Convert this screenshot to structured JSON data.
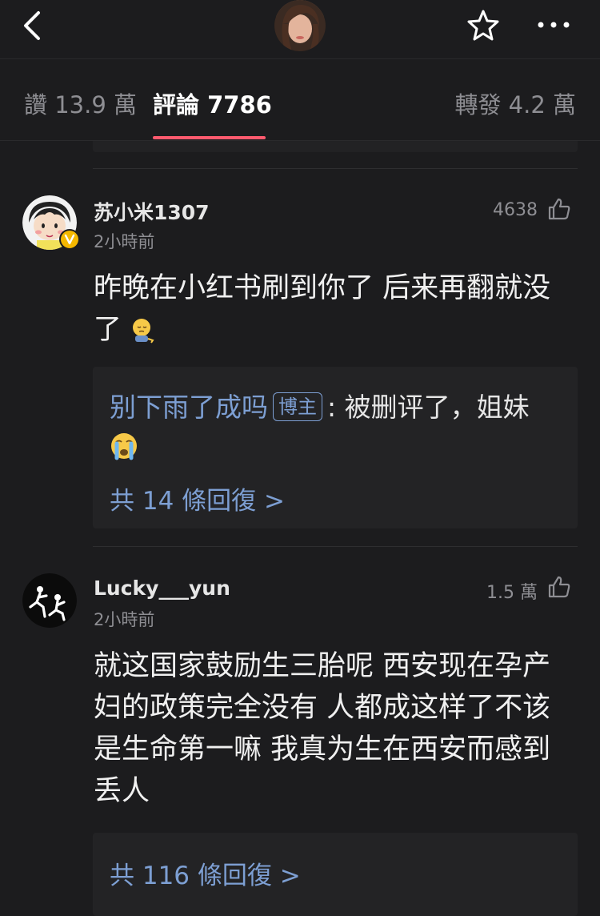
{
  "header": {
    "back_icon": "chevron-left-icon",
    "avatar": "user-avatar",
    "star_icon": "star-icon",
    "more_icon": "more-dots-icon"
  },
  "tabs": [
    {
      "label": "讚 13.9 萬",
      "active": false
    },
    {
      "label": "評論 7786",
      "active": true
    },
    {
      "label": "轉發 4.2 萬",
      "active": false
    }
  ],
  "colors": {
    "accent": "#ff5a6e",
    "link": "#7d9fd3",
    "verified": "#f5b800"
  },
  "comments": [
    {
      "user": "苏小米1307",
      "time": "2小時前",
      "likes": "4638",
      "text": "昨晚在小红书刷到你了 后来再翻就没了",
      "text_emoji": "pensive-emoji",
      "reply": {
        "author": "别下雨了成吗",
        "badge": "博主",
        "separator": ":",
        "text": "被删评了，姐妹",
        "text_emoji": "crying-emoji",
        "count": "共 14 條回復 >"
      }
    },
    {
      "user": "Lucky___yun",
      "time": "2小時前",
      "likes": "1.5 萬",
      "text": "就这国家鼓励生三胎呢 西安现在孕产妇的政策完全没有 人都成这样了不该是生命第一嘛 我真为生在西安而感到丢人",
      "reply": {
        "count": "共 116 條回復 >"
      }
    }
  ]
}
